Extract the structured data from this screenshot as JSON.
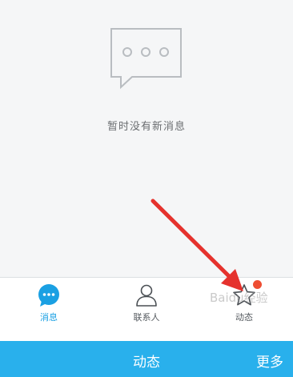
{
  "empty_state": {
    "icon": "speech-bubble-ellipsis-icon",
    "message": "暂时没有新消息"
  },
  "tabs": [
    {
      "label": "消息",
      "icon": "message-bubble-icon",
      "active": true
    },
    {
      "label": "联系人",
      "icon": "person-icon",
      "active": false
    },
    {
      "label": "动态",
      "icon": "star-icon",
      "active": false,
      "has_badge": true
    }
  ],
  "bottom_bar": {
    "title": "动态",
    "more_label": "更多"
  },
  "watermark": "Baidu经验",
  "colors": {
    "accent": "#1aa0e3",
    "bottom_bar": "#29b0ec",
    "badge": "#ee4e33",
    "arrow": "#e5322d"
  }
}
